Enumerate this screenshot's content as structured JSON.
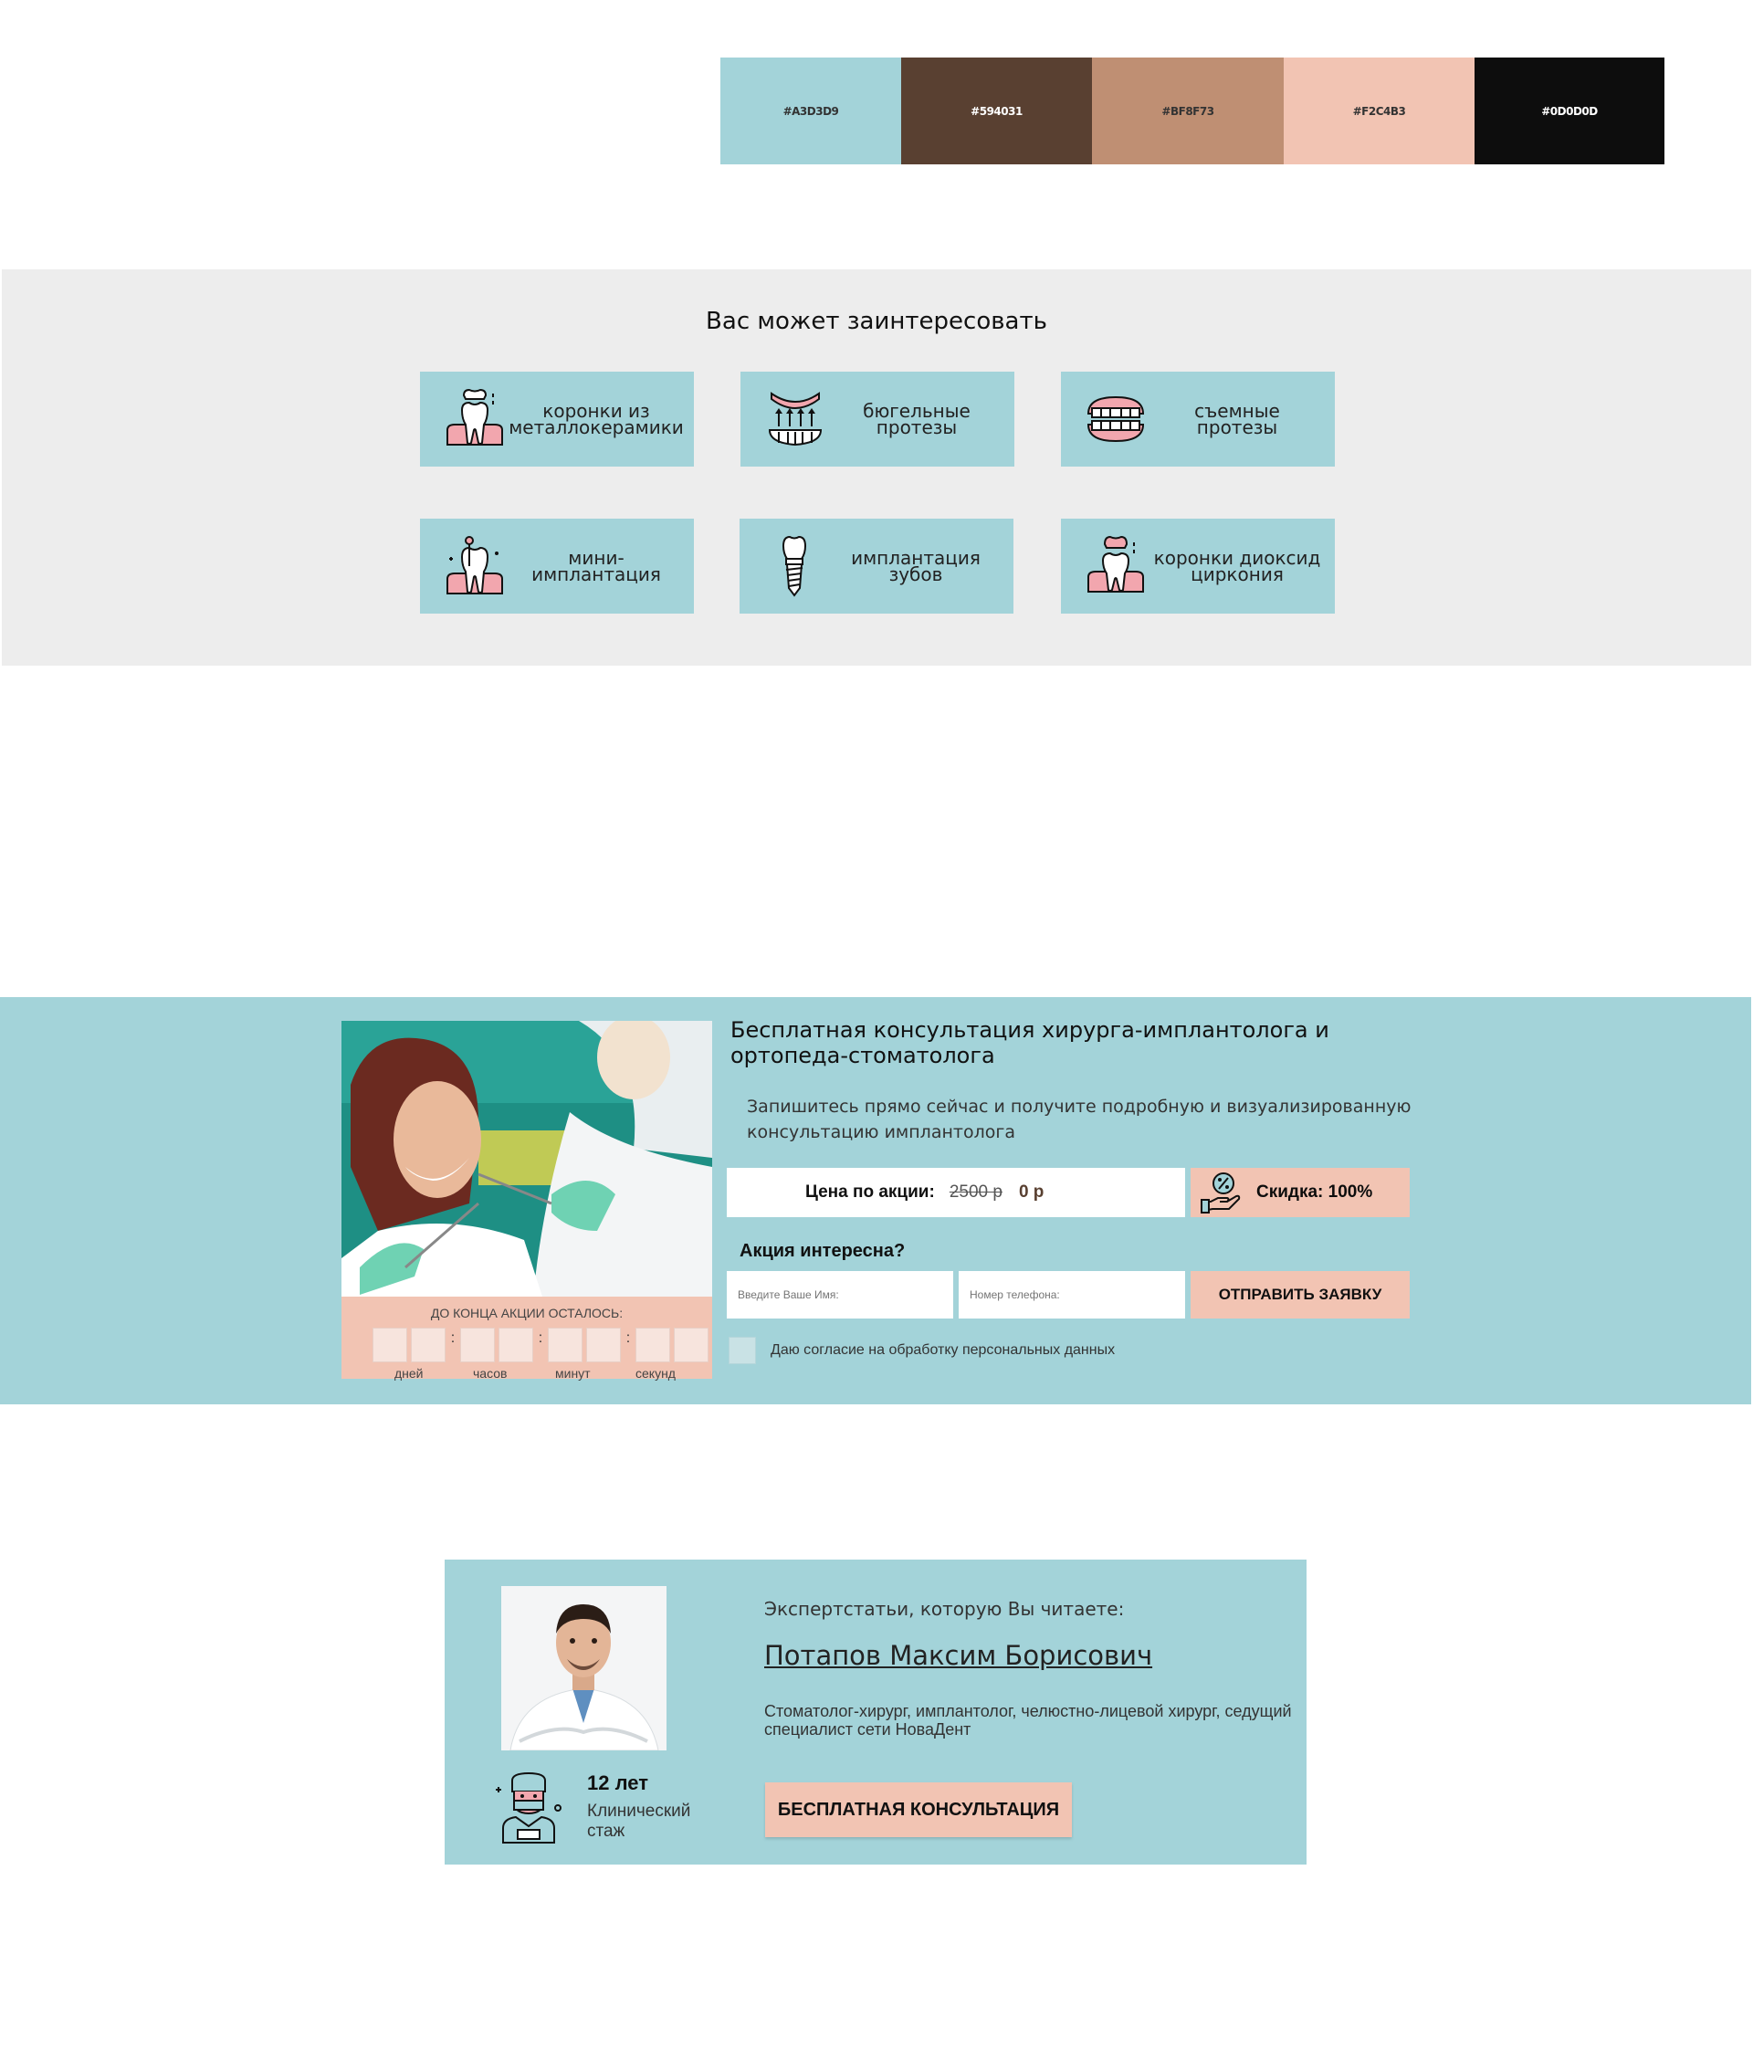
{
  "palette": [
    {
      "hex": "#A3D3D9",
      "label": "#A3D3D9",
      "text_color": "#333333"
    },
    {
      "hex": "#594031",
      "label": "#594031",
      "text_color": "#ffffff"
    },
    {
      "hex": "#BF8F73",
      "label": "#BF8F73",
      "text_color": "#333333"
    },
    {
      "hex": "#F2C4B3",
      "label": "#F2C4B3",
      "text_color": "#333333"
    },
    {
      "hex": "#0D0D0D",
      "label": "#0D0D0D",
      "text_color": "#ffffff"
    }
  ],
  "interest": {
    "title": "Вас может заинтересовать",
    "cards": [
      {
        "label": "коронки из\nметаллокерамики",
        "icon": "tooth-crown-icon"
      },
      {
        "label": "бюгельные\nпротезы",
        "icon": "clasp-prosthesis-icon"
      },
      {
        "label": "съемные\nпротезы",
        "icon": "removable-dentures-icon"
      },
      {
        "label": "мини-\nимплантация",
        "icon": "mini-implant-icon"
      },
      {
        "label": "имплантация\nзубов",
        "icon": "dental-implant-icon"
      },
      {
        "label": "коронки диоксид\nциркония",
        "icon": "zirconia-crown-icon"
      }
    ]
  },
  "promo": {
    "title": "Бесплатная консультация хирурга-имплантолога и ортопеда-стоматолога",
    "subtitle": "Запишитесь прямо сейчас и получите подробную и визуализированную консультацию имплантолога",
    "countdown_label": "ДО КОНЦА АКЦИИ ОСТАЛОСЬ:",
    "countdown_units": [
      "дней",
      "часов",
      "минут",
      "секунд"
    ],
    "price_label": "Цена по акции:",
    "old_price": "2500 р",
    "new_price": "0 р",
    "discount": "Скидка: 100%",
    "question": "Акция интересна?",
    "name_placeholder": "Введите Ваше Имя:",
    "phone_placeholder": "Номер телефона:",
    "submit": "ОТПРАВИТЬ ЗАЯВКУ",
    "consent": "Даю согласие на обработку персональных данных"
  },
  "expert": {
    "label": "Экспертстатьи, которую Вы читаете:",
    "name": "Потапов Максим Борисович",
    "description": "Стоматолог-хирург, имплантолог, челюстно-лицевой хирург, седущий специалист сети НоваДент",
    "years": "12 лет",
    "years_caption": "Клинический стаж",
    "button": "БЕСПЛАТНАЯ КОНСУЛЬТАЦИЯ"
  }
}
